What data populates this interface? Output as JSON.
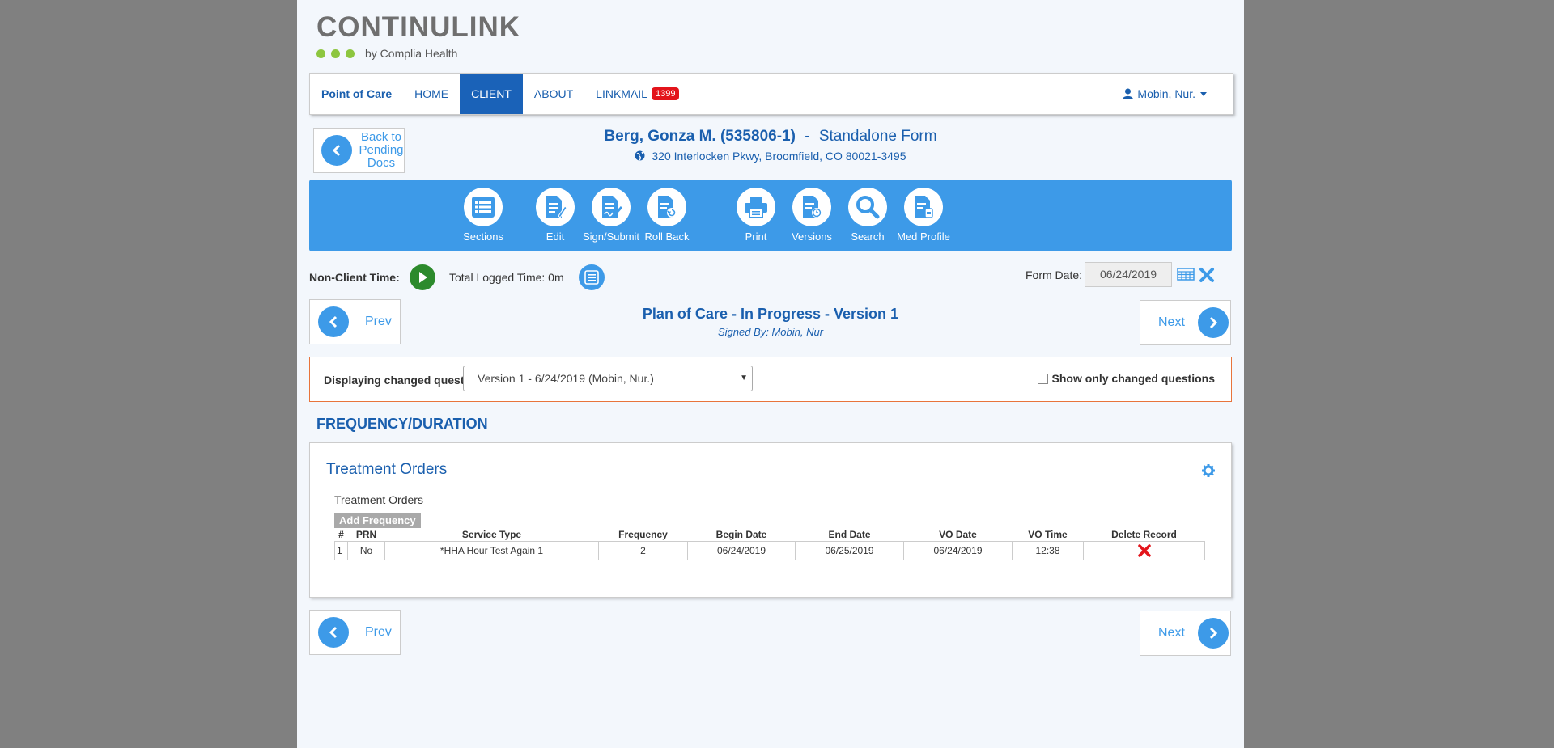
{
  "logo": {
    "name": "CONTINULINK",
    "tagline": "by Complia Health"
  },
  "nav": {
    "brand": "Point of Care",
    "items": [
      "HOME",
      "CLIENT",
      "ABOUT",
      "LINKMAIL"
    ],
    "active": "CLIENT",
    "linkmail_count": "1399",
    "user": "Mobin, Nur."
  },
  "back_button": {
    "label": "Back to Pending Docs"
  },
  "client": {
    "name": "Berg, Gonza M. (535806-1)",
    "separator": "-",
    "form_type": "Standalone Form",
    "address": "320 Interlocken Pkwy, Broomfield, CO 80021-3495"
  },
  "toolbar": [
    {
      "label": "Sections",
      "icon": "sections-icon"
    },
    {
      "label": "Edit",
      "icon": "edit-icon"
    },
    {
      "label": "Sign/Submit",
      "icon": "sign-submit-icon"
    },
    {
      "label": "Roll Back",
      "icon": "roll-back-icon"
    },
    {
      "label": "Print",
      "icon": "print-icon"
    },
    {
      "label": "Versions",
      "icon": "versions-icon"
    },
    {
      "label": "Search",
      "icon": "search-icon"
    },
    {
      "label": "Med Profile",
      "icon": "med-profile-icon"
    }
  ],
  "time": {
    "non_client_label": "Non-Client Time:",
    "total_logged": "Total Logged Time: 0m",
    "form_date_label": "Form Date:",
    "form_date_value": "06/24/2019"
  },
  "pager": {
    "prev": "Prev",
    "next": "Next"
  },
  "document": {
    "title": "Plan of Care",
    "status": "- In Progress",
    "version": "- Version 1",
    "signed_by": "Signed By: Mobin, Nur"
  },
  "changes": {
    "label": "Displaying changed questions in:",
    "selected_version": "Version 1 - 6/24/2019 (Mobin, Nur.)",
    "show_only_label": "Show only changed questions"
  },
  "section": {
    "heading": "FREQUENCY/DURATION",
    "panel_title": "Treatment Orders",
    "sub_label": "Treatment Orders",
    "add_button": "Add Frequency",
    "columns": [
      "#",
      "PRN",
      "Service Type",
      "Frequency",
      "Begin Date",
      "End Date",
      "VO Date",
      "VO Time",
      "Delete Record"
    ],
    "rows": [
      {
        "num": "1",
        "prn": "No",
        "service_type": "*HHA Hour Test Again 1",
        "frequency": "2",
        "begin_date": "06/24/2019",
        "end_date": "06/25/2019",
        "vo_date": "06/24/2019",
        "vo_time": "12:38"
      }
    ]
  },
  "colors": {
    "primary": "#3d9ae8",
    "dark_blue": "#1a5fae",
    "nav_active": "#1a62b8",
    "badge": "#e3141b",
    "logo_dot": "#8dc63f",
    "alert_border": "#e8743b",
    "play": "#2c8a2c",
    "delete": "#e3141b"
  }
}
